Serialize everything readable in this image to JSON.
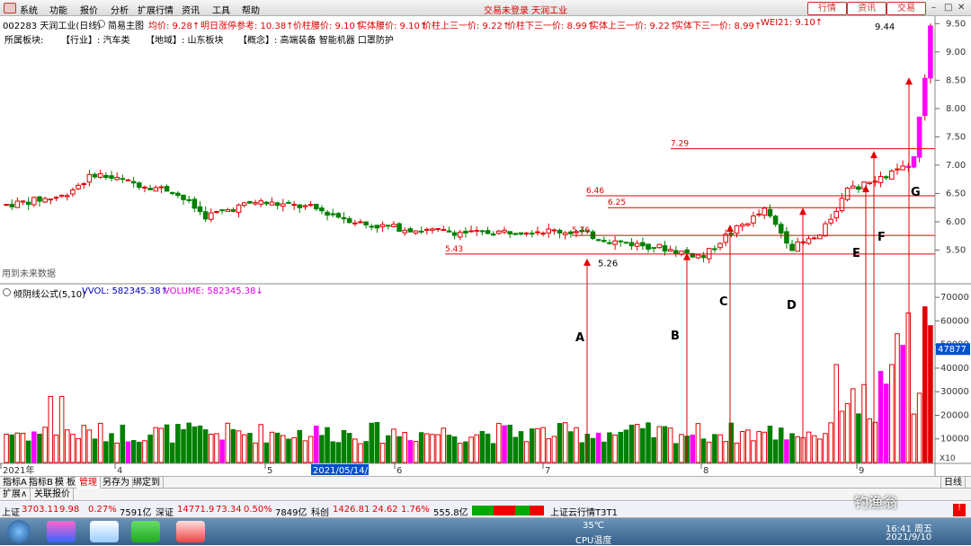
{
  "menu": [
    "系统",
    "功能",
    "报价",
    "分析",
    "扩展行情",
    "资讯",
    "工具",
    "帮助"
  ],
  "center_title": "交易未登录 天润工业",
  "top_buttons": [
    "行情",
    "资讯",
    "交易"
  ],
  "info": {
    "code_name": "002283 天润工业(日线)",
    "template": "简易主图",
    "fields": [
      {
        "label": "均价: 9.28↑",
        "color": "#e00000"
      },
      {
        "label": "明日涨停参考: 10.38↑",
        "color": "#e00000"
      },
      {
        "label": "价柱腰价: 9.10↑",
        "color": "#e00000"
      },
      {
        "label": "实体腰价: 9.10↑",
        "color": "#e00000"
      },
      {
        "label": "价柱上三一价: 9.22↑",
        "color": "#e00000"
      },
      {
        "label": "价柱下三一价: 8.99↑",
        "color": "#e00000"
      },
      {
        "label": "实体上三一价: 9.22↑",
        "color": "#e00000"
      },
      {
        "label": "实体下三一价: 8.99↑",
        "color": "#e00000"
      },
      {
        "label": "WEI21: 9.10↑",
        "color": "#e00000"
      }
    ],
    "sector_label": "所属板块:",
    "industry": "【行业】: 汽车类",
    "region": "【地域】: 山东板块",
    "concept": "【概念】: 高端装备 智能机器 口罩防护"
  },
  "chart_text": {
    "future_data": "用到未来数据",
    "indicator_title": "倾阴线公式(5,10)",
    "vvol": "VVOL: 582345.38↑",
    "volume": "VOLUME: 582345.38↓",
    "current_vol_tag": "47877",
    "x10": "X10"
  },
  "annotations": {
    "levels": [
      "5.43",
      "5.76",
      "6.25",
      "6.46",
      "7.29",
      "9.44",
      "5.26"
    ],
    "letters": [
      "A",
      "B",
      "C",
      "D",
      "E",
      "F",
      "G"
    ]
  },
  "x_axis": {
    "labels": [
      "2021年",
      "4",
      "5",
      "2021/05/14/五",
      "6",
      "7",
      "8",
      "9"
    ],
    "period": "日线"
  },
  "tabs1": [
    "指标A",
    "指标B",
    "模 板",
    "管理",
    "另存为",
    "绑定到"
  ],
  "tabs2": [
    "扩展∧",
    "关联报价"
  ],
  "status": {
    "sh": "上证",
    "sh_val": "3703.11",
    "sh_chg": "9.98",
    "sh_pct": "0.27%",
    "sh_amt": "7591亿",
    "sz": "深证",
    "sz_val": "14771.9",
    "sz_chg": "73.34",
    "sz_pct": "0.50%",
    "sz_amt": "7849亿",
    "kc": "科创",
    "kc_val": "1426.81",
    "kc_chg": "24.62",
    "kc_pct": "1.76%",
    "kc_amt": "555.8亿",
    "cloud": "上证云行情T3T1"
  },
  "taskbar": {
    "temp": "35℃",
    "cpu": "CPU温度",
    "time": "16:41 周五",
    "date": "2021/9/10",
    "watermark": "钓渔翁"
  },
  "chart_data": {
    "type": "candlestick",
    "price_axis": {
      "ticks": [
        "9.50",
        "9.00",
        "8.50",
        "8.00",
        "7.50",
        "7.00",
        "6.50",
        "6.00",
        "5.50"
      ],
      "range": [
        5.0,
        9.6
      ]
    },
    "volume_axis": {
      "ticks": [
        "70000",
        "60000",
        "50000",
        "40000",
        "30000",
        "20000",
        "10000"
      ],
      "range": [
        0,
        75000
      ]
    },
    "note": "approximate daily OHLC / volume read from chart",
    "up_color": "#e00000",
    "down_color": "#008000",
    "highlight_color": "#ff00ff"
  }
}
